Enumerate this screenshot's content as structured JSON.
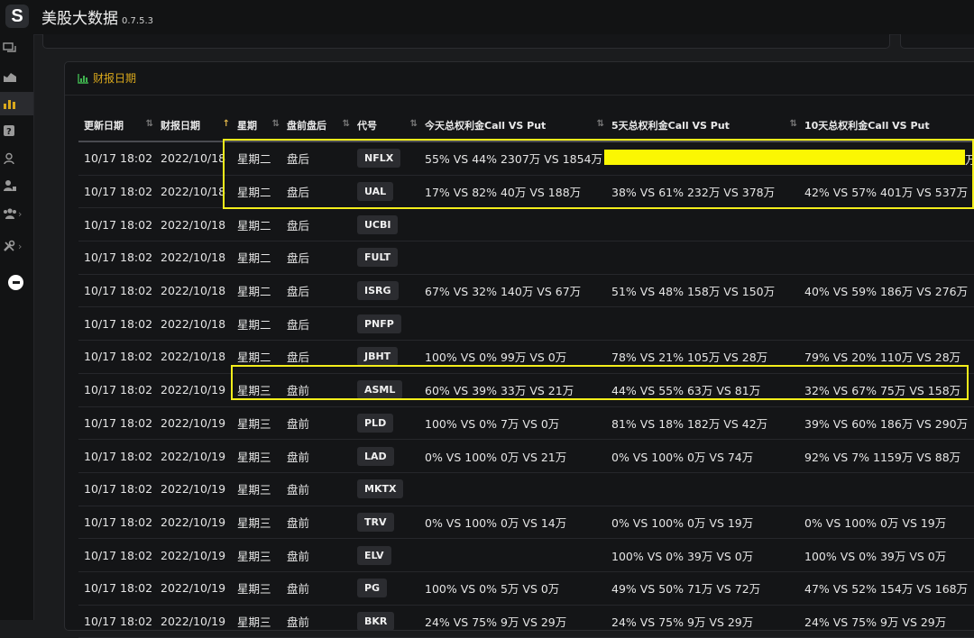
{
  "app": {
    "title": "美股大数据",
    "version": "0.7.5.3",
    "logo_letter": "S"
  },
  "sidebar": {
    "items": [
      {
        "icon": "chat-icon"
      },
      {
        "icon": "chart-area-icon"
      },
      {
        "icon": "bar-chart-icon",
        "active": true
      },
      {
        "icon": "question-icon"
      },
      {
        "icon": "user-icon"
      },
      {
        "icon": "user-admin-icon"
      },
      {
        "icon": "group-icon",
        "chevron": "›"
      },
      {
        "icon": "tools-icon",
        "chevron": "›"
      },
      {
        "icon": "toggle-icon"
      }
    ]
  },
  "panel": {
    "title": "财报日期",
    "icon": "bar-chart-icon"
  },
  "accent": "#d9a81c",
  "highlight_color": "#f4ee1b",
  "table": {
    "headers": {
      "updated": "更新日期",
      "report_date": "财报日期",
      "weekday": "星期",
      "session": "盘前盘后",
      "code": "代号",
      "today": "今天总权利金Call VS Put",
      "five_day": "5天总权利金Call VS Put",
      "ten_day": "10天总权利金Call VS Put"
    },
    "sort_icons": {
      "default": "⇅",
      "active": "↑"
    },
    "rows": [
      {
        "updated": "10/17 18:02",
        "date": "2022/10/18",
        "weekday": "星期二",
        "session": "盘后",
        "code": "NFLX",
        "today": "55% VS 44% 2307万 VS 1854万",
        "five": "",
        "ten": "",
        "redacted": true,
        "tail": "万"
      },
      {
        "updated": "10/17 18:02",
        "date": "2022/10/18",
        "weekday": "星期二",
        "session": "盘后",
        "code": "UAL",
        "today": "17% VS 82% 40万 VS 188万",
        "five": "38% VS 61% 232万 VS 378万",
        "ten": "42% VS 57% 401万 VS 537万"
      },
      {
        "updated": "10/17 18:02",
        "date": "2022/10/18",
        "weekday": "星期二",
        "session": "盘后",
        "code": "UCBI",
        "today": "",
        "five": "",
        "ten": ""
      },
      {
        "updated": "10/17 18:02",
        "date": "2022/10/18",
        "weekday": "星期二",
        "session": "盘后",
        "code": "FULT",
        "today": "",
        "five": "",
        "ten": ""
      },
      {
        "updated": "10/17 18:02",
        "date": "2022/10/18",
        "weekday": "星期二",
        "session": "盘后",
        "code": "ISRG",
        "today": "67% VS 32% 140万 VS 67万",
        "five": "51% VS 48% 158万 VS 150万",
        "ten": "40% VS 59% 186万 VS 276万"
      },
      {
        "updated": "10/17 18:02",
        "date": "2022/10/18",
        "weekday": "星期二",
        "session": "盘后",
        "code": "PNFP",
        "today": "",
        "five": "",
        "ten": ""
      },
      {
        "updated": "10/17 18:02",
        "date": "2022/10/18",
        "weekday": "星期二",
        "session": "盘后",
        "code": "JBHT",
        "today": "100% VS 0% 99万 VS 0万",
        "five": "78% VS 21% 105万 VS 28万",
        "ten": "79% VS 20% 110万 VS 28万"
      },
      {
        "updated": "10/17 18:02",
        "date": "2022/10/19",
        "weekday": "星期三",
        "session": "盘前",
        "code": "ASML",
        "today": "60% VS 39% 33万 VS 21万",
        "five": "44% VS 55% 63万 VS 81万",
        "ten": "32% VS 67% 75万 VS 158万"
      },
      {
        "updated": "10/17 18:02",
        "date": "2022/10/19",
        "weekday": "星期三",
        "session": "盘前",
        "code": "PLD",
        "today": "100% VS 0% 7万 VS 0万",
        "five": "81% VS 18% 182万 VS 42万",
        "ten": "39% VS 60% 186万 VS 290万"
      },
      {
        "updated": "10/17 18:02",
        "date": "2022/10/19",
        "weekday": "星期三",
        "session": "盘前",
        "code": "LAD",
        "today": "0% VS 100% 0万 VS 21万",
        "five": "0% VS 100% 0万 VS 74万",
        "ten": "92% VS 7% 1159万 VS 88万"
      },
      {
        "updated": "10/17 18:02",
        "date": "2022/10/19",
        "weekday": "星期三",
        "session": "盘前",
        "code": "MKTX",
        "today": "",
        "five": "",
        "ten": ""
      },
      {
        "updated": "10/17 18:02",
        "date": "2022/10/19",
        "weekday": "星期三",
        "session": "盘前",
        "code": "TRV",
        "today": "0% VS 100% 0万 VS 14万",
        "five": "0% VS 100% 0万 VS 19万",
        "ten": "0% VS 100% 0万 VS 19万"
      },
      {
        "updated": "10/17 18:02",
        "date": "2022/10/19",
        "weekday": "星期三",
        "session": "盘前",
        "code": "ELV",
        "today": "",
        "five": "100% VS 0% 39万 VS 0万",
        "ten": "100% VS 0% 39万 VS 0万"
      },
      {
        "updated": "10/17 18:02",
        "date": "2022/10/19",
        "weekday": "星期三",
        "session": "盘前",
        "code": "PG",
        "today": "100% VS 0% 5万 VS 0万",
        "five": "49% VS 50% 71万 VS 72万",
        "ten": "47% VS 52% 154万 VS 168万"
      },
      {
        "updated": "10/17 18:02",
        "date": "2022/10/19",
        "weekday": "星期三",
        "session": "盘前",
        "code": "BKR",
        "today": "24% VS 75% 9万 VS 29万",
        "five": "24% VS 75% 9万 VS 29万",
        "ten": "24% VS 75% 9万 VS 29万"
      }
    ]
  }
}
